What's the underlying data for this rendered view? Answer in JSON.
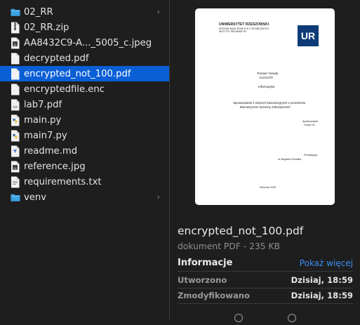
{
  "files": [
    {
      "name": "02_RR",
      "icon": "folder-icon",
      "has_chevron": true
    },
    {
      "name": "02_RR.zip",
      "icon": "zip-file-icon"
    },
    {
      "name": "AA8432C9-A..._5005_c.jpeg",
      "icon": "image-file-icon"
    },
    {
      "name": "decrypted.pdf",
      "icon": "document-icon"
    },
    {
      "name": "encrypted_not_100.pdf",
      "icon": "document-icon",
      "selected": true
    },
    {
      "name": "encryptedfile.enc",
      "icon": "document-icon"
    },
    {
      "name": "lab7.pdf",
      "icon": "pdf-file-icon"
    },
    {
      "name": "main.py",
      "icon": "python-file-icon"
    },
    {
      "name": "main7.py",
      "icon": "python-file-icon"
    },
    {
      "name": "readme.md",
      "icon": "markdown-file-icon"
    },
    {
      "name": "reference.jpg",
      "icon": "image-file-icon"
    },
    {
      "name": "requirements.txt",
      "icon": "text-file-icon"
    },
    {
      "name": "venv",
      "icon": "folder-icon",
      "has_chevron": true
    }
  ],
  "preview": {
    "doc": {
      "university": "UNIWERSYTET RZESZOWSKI",
      "faculty1": "WYDZIAŁ NAUK ŚCISŁYCH I TECHNICZNYCH",
      "faculty2": "INSTYTUT INFORMATYKI",
      "logo_text": "UR",
      "author": "Tomasz Nowak",
      "index": "tn131478",
      "field": "Informatyka",
      "title1": "Sprawozdanie z ćwiczeń laboratoryjnych z przedmiotu",
      "title2": "Biometryczne Systemy Zabezpieczeń",
      "report1": "Sprawozdanie",
      "report2": "Grupa: 03",
      "teacher1": "Prowadzący",
      "teacher2": "dr Zbigniew Gomółka",
      "footer": "Rzeszów 2025"
    },
    "file_name": "encrypted_not_100.pdf",
    "file_sub": "dokument PDF - 235 KB",
    "info_heading": "Informacje",
    "show_more": "Pokaż więcej",
    "created_label": "Utworzono",
    "created_value": "Dzisiaj, 18:59",
    "modified_label": "Zmodyfikowano",
    "modified_value": "Dzisiaj, 18:59"
  },
  "colors": {
    "selection": "#0a5fd6",
    "folder": "#3aa3e3",
    "link": "#3b8ef0"
  }
}
